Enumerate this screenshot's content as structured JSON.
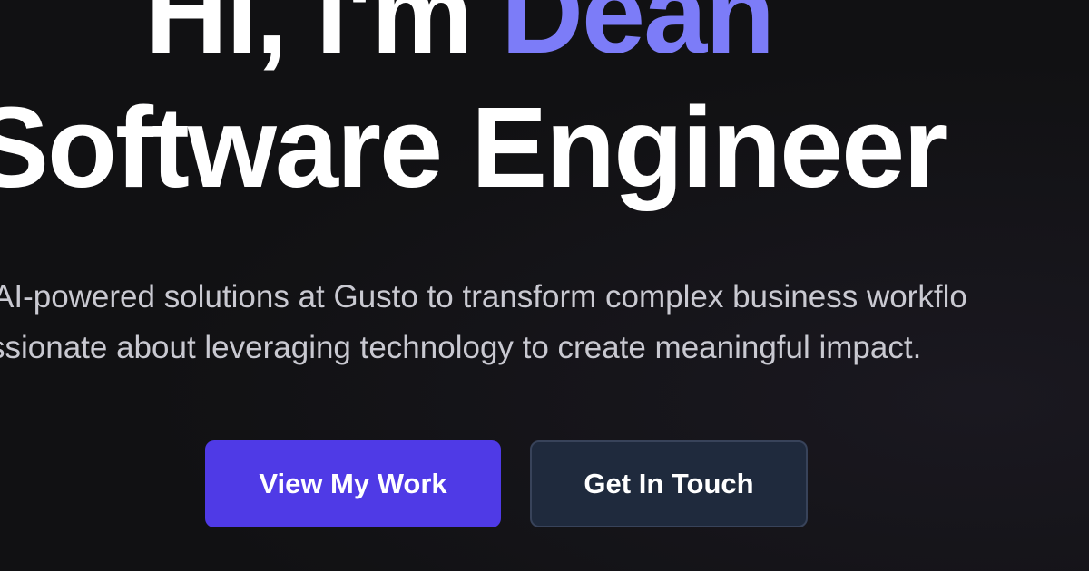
{
  "hero": {
    "greeting_prefix": "Hi, I'm ",
    "name": "Dean",
    "role": "Software Engineer",
    "tagline_line1": "AI-powered solutions at Gusto to transform complex business workflo",
    "tagline_line2": "ssionate about leveraging technology to create meaningful impact."
  },
  "actions": {
    "primary_label": "View My Work",
    "secondary_label": "Get In Touch"
  },
  "colors": {
    "background": "#111113",
    "accent": "#7c7cf8",
    "primary_button": "#4f3ae6",
    "secondary_button": "#1f2a3d"
  }
}
